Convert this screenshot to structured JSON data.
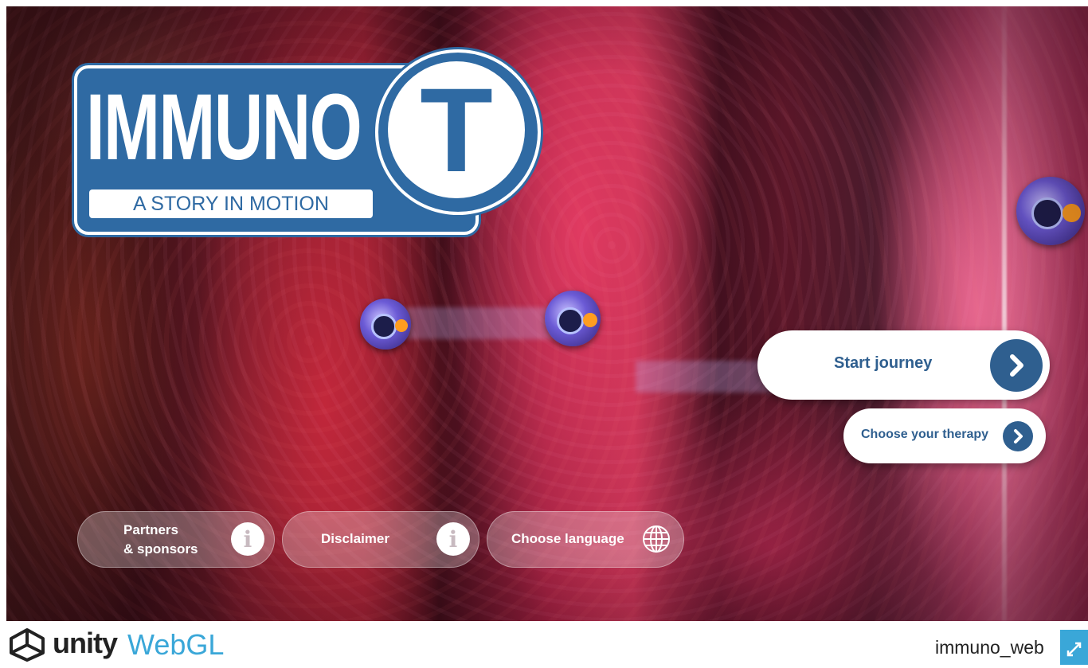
{
  "logo": {
    "title": "IMMUNO",
    "letter": "T",
    "subtitle": "A STORY IN MOTION"
  },
  "menu": {
    "start_label": "Start journey",
    "therapy_label": "Choose your therapy"
  },
  "bottom_buttons": {
    "partners_label": "Partners\n& sponsors",
    "disclaimer_label": "Disclaimer",
    "language_label": "Choose language"
  },
  "footer": {
    "engine_name": "unity",
    "engine_product": "WebGL",
    "project_name": "immuno_web"
  },
  "colors": {
    "brand_blue": "#2f6aa3",
    "button_blue": "#2f5f8f",
    "webgl_blue": "#3aa7d8"
  },
  "icons": [
    "chevron-right-icon",
    "info-icon",
    "globe-icon",
    "unity-logo-icon",
    "fullscreen-icon"
  ]
}
